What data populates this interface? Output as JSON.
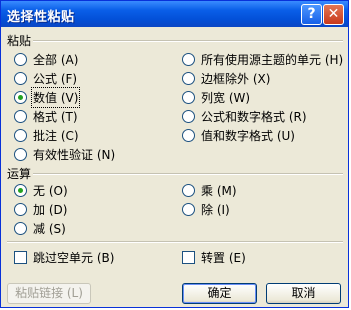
{
  "window": {
    "title": "选择性粘贴",
    "help_glyph": "?",
    "close_glyph": "✕"
  },
  "paste": {
    "label": "粘贴",
    "left": [
      {
        "label": "全部 (A)",
        "selected": false
      },
      {
        "label": "公式 (F)",
        "selected": false
      },
      {
        "label": "数值 (V)",
        "selected": true
      },
      {
        "label": "格式 (T)",
        "selected": false
      },
      {
        "label": "批注 (C)",
        "selected": false
      },
      {
        "label": "有效性验证 (N)",
        "selected": false
      }
    ],
    "right": [
      {
        "label": "所有使用源主题的单元 (H)",
        "selected": false
      },
      {
        "label": "边框除外 (X)",
        "selected": false
      },
      {
        "label": "列宽 (W)",
        "selected": false
      },
      {
        "label": "公式和数字格式 (R)",
        "selected": false
      },
      {
        "label": "值和数字格式 (U)",
        "selected": false
      }
    ]
  },
  "operation": {
    "label": "运算",
    "left": [
      {
        "label": "无 (O)",
        "selected": true
      },
      {
        "label": "加 (D)",
        "selected": false
      },
      {
        "label": "减 (S)",
        "selected": false
      }
    ],
    "right": [
      {
        "label": "乘 (M)",
        "selected": false
      },
      {
        "label": "除 (I)",
        "selected": false
      }
    ]
  },
  "checkboxes": {
    "skip_blanks": {
      "label": "跳过空单元 (B)",
      "checked": false
    },
    "transpose": {
      "label": "转置 (E)",
      "checked": false
    }
  },
  "buttons": {
    "paste_link": "粘贴链接 (L)",
    "ok": "确定",
    "cancel": "取消"
  }
}
